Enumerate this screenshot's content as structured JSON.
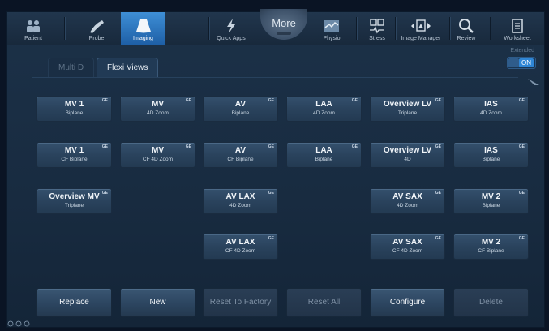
{
  "toolbar": {
    "items": [
      {
        "label": "Patient",
        "icon": "patient-icon"
      },
      {
        "label": "Probe",
        "icon": "probe-icon"
      },
      {
        "label": "Imaging",
        "icon": "imaging-icon",
        "active": true
      },
      {
        "label": "Quick Apps",
        "icon": "quick-apps-icon"
      },
      {
        "label": "Physio",
        "icon": "physio-icon"
      },
      {
        "label": "Stress",
        "icon": "stress-icon"
      },
      {
        "label": "Image Manager",
        "icon": "image-manager-icon"
      },
      {
        "label": "Review",
        "icon": "review-icon"
      },
      {
        "label": "Worksheet",
        "icon": "worksheet-icon"
      }
    ],
    "more_label": "More"
  },
  "tabs": {
    "multi_d": "Multi D",
    "flexi_views": "Flexi Views"
  },
  "extended": {
    "label": "Extended",
    "state": "ON"
  },
  "grid": [
    {
      "main": "MV 1",
      "sub": "Biplane",
      "badge": "GE"
    },
    {
      "main": "MV",
      "sub": "4D Zoom",
      "badge": "GE"
    },
    {
      "main": "AV",
      "sub": "Biplane",
      "badge": "GE"
    },
    {
      "main": "LAA",
      "sub": "4D Zoom",
      "badge": "GE"
    },
    {
      "main": "Overview LV",
      "sub": "Triplane",
      "badge": "GE"
    },
    {
      "main": "IAS",
      "sub": "4D Zoom",
      "badge": "GE"
    },
    {
      "main": "MV 1",
      "sub": "CF Biplane",
      "badge": "GE"
    },
    {
      "main": "MV",
      "sub": "CF 4D Zoom",
      "badge": "GE"
    },
    {
      "main": "AV",
      "sub": "CF Biplane",
      "badge": "GE"
    },
    {
      "main": "LAA",
      "sub": "Biplane",
      "badge": "GE"
    },
    {
      "main": "Overview LV",
      "sub": "4D",
      "badge": "GE"
    },
    {
      "main": "IAS",
      "sub": "Biplane",
      "badge": "GE"
    },
    {
      "main": "Overview MV",
      "sub": "Triplane",
      "badge": "GE"
    },
    {
      "main": "AV LAX",
      "sub": "4D Zoom",
      "badge": "GE"
    },
    {
      "main": "AV SAX",
      "sub": "4D Zoom",
      "badge": "GE"
    },
    {
      "main": "MV 2",
      "sub": "Biplane",
      "badge": "GE"
    },
    {
      "main": "AV LAX",
      "sub": "CF 4D Zoom",
      "badge": "GE"
    },
    {
      "main": "AV SAX",
      "sub": "CF 4D Zoom",
      "badge": "GE"
    },
    {
      "main": "MV 2",
      "sub": "CF Biplane",
      "badge": "GE"
    }
  ],
  "bottom": {
    "replace": "Replace",
    "new": "New",
    "reset_factory": "Reset To Factory",
    "reset_all": "Reset All",
    "configure": "Configure",
    "delete": "Delete"
  },
  "colors": {
    "active_tab": "#2f86d6",
    "background": "#1c3148",
    "button": "#2a435d"
  }
}
